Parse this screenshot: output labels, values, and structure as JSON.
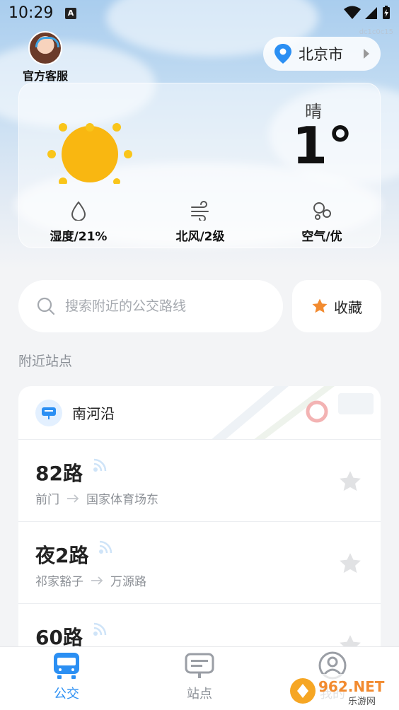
{
  "status_bar": {
    "time": "10:29",
    "notification_badge": "A"
  },
  "corner_id": "dc1c0c15",
  "service": {
    "label": "官方客服",
    "icon": "customer-service-avatar"
  },
  "location": {
    "city": "北京市",
    "icon": "location-pin-icon"
  },
  "weather": {
    "condition": "晴",
    "temperature": "1°",
    "humidity": "湿度/21%",
    "wind": "北风/2级",
    "air": "空气/优"
  },
  "search": {
    "placeholder": "搜索附近的公交路线"
  },
  "favorites": {
    "label": "收藏"
  },
  "nearby": {
    "title": "附近站点",
    "station": "南河沿",
    "routes": [
      {
        "name": "82路",
        "from": "前门",
        "to": "国家体育场东"
      },
      {
        "name": "夜2路",
        "from": "祁家豁子",
        "to": "万源路"
      },
      {
        "name": "60路",
        "from": "",
        "to": ""
      }
    ]
  },
  "tabs": [
    {
      "label": "公交",
      "icon": "bus-icon",
      "active": true
    },
    {
      "label": "站点",
      "icon": "station-sign-icon",
      "active": false
    },
    {
      "label": "我的",
      "icon": "user-icon",
      "active": false
    }
  ],
  "watermark": {
    "brand": "962.NET",
    "sub": "乐游网"
  },
  "colors": {
    "accent": "#2b8ff3",
    "star_active": "#f28b30",
    "star_inactive": "#e1e2e4",
    "sun": "#f9b711"
  }
}
